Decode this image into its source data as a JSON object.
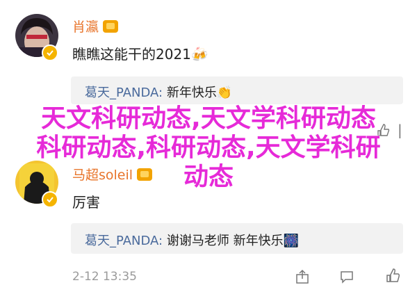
{
  "comments": [
    {
      "username": "肖瀛",
      "text": "瞧瞧这能干的2021",
      "text_emoji": "🍻",
      "reply": {
        "user": "葛天_PANDA",
        "sep": ":",
        "content": "新年快乐",
        "emoji": "👏"
      }
    },
    {
      "username": "马超soleil",
      "text": "厉害",
      "reply": {
        "user": "葛天_PANDA",
        "sep": ":",
        "content": "谢谢马老师 新年快乐",
        "emoji": "🎆"
      },
      "timestamp": "2-12 13:35"
    }
  ],
  "watermark": {
    "line1": "天文科研动态,天文学科研动态",
    "line2": "科研动态,科研动态,天文学科研",
    "line3": "动态"
  },
  "icons": {
    "share": "share-icon",
    "comment": "comment-icon",
    "like": "thumbs-up-icon",
    "verify": "verified-icon"
  },
  "colors": {
    "username": "#e8742a",
    "reply_user": "#4a6a9c",
    "watermark": "#e62ad8",
    "verify": "#f5b400"
  }
}
